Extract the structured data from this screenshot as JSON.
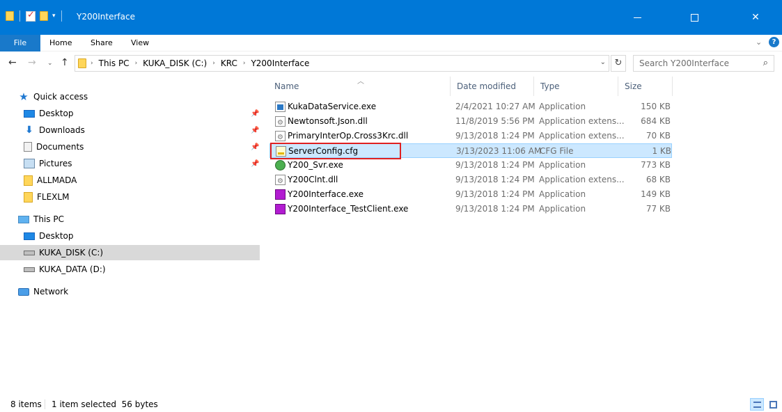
{
  "window": {
    "title": "Y200Interface",
    "min_icon": "minimize-icon",
    "max_icon": "maximize-icon",
    "close_label": "✕"
  },
  "ribbon": {
    "tabs": [
      {
        "label": "File",
        "active": true
      },
      {
        "label": "Home"
      },
      {
        "label": "Share"
      },
      {
        "label": "View"
      }
    ],
    "help_label": "?"
  },
  "address": {
    "crumbs": [
      "This PC",
      "KUKA_DISK (C:)",
      "KRC",
      "Y200Interface"
    ],
    "search_placeholder": "Search Y200Interface"
  },
  "nav_pane": {
    "quick_access": {
      "label": "Quick access",
      "items": [
        {
          "label": "Desktop",
          "icon": "desktop-icon",
          "pinned": true
        },
        {
          "label": "Downloads",
          "icon": "downloads-icon",
          "pinned": true
        },
        {
          "label": "Documents",
          "icon": "documents-icon",
          "pinned": true
        },
        {
          "label": "Pictures",
          "icon": "pictures-icon",
          "pinned": true
        },
        {
          "label": "ALLMADA",
          "icon": "folder-icon",
          "pinned": false
        },
        {
          "label": "FLEXLM",
          "icon": "folder-icon",
          "pinned": false
        }
      ]
    },
    "this_pc": {
      "label": "This PC",
      "items": [
        {
          "label": "Desktop",
          "icon": "desktop-icon"
        },
        {
          "label": "KUKA_DISK (C:)",
          "icon": "drive-icon",
          "selected": true
        },
        {
          "label": "KUKA_DATA (D:)",
          "icon": "drive-icon"
        }
      ]
    },
    "network": {
      "label": "Network"
    }
  },
  "columns": {
    "name": "Name",
    "date": "Date modified",
    "type": "Type",
    "size": "Size"
  },
  "files": [
    {
      "name": "KukaDataService.exe",
      "date": "2/4/2021 10:27 AM",
      "type": "Application",
      "size": "150 KB",
      "icon": "exe-icon"
    },
    {
      "name": "Newtonsoft.Json.dll",
      "date": "11/8/2019 5:56 PM",
      "type": "Application extens...",
      "size": "684 KB",
      "icon": "dll-icon"
    },
    {
      "name": "PrimaryInterOp.Cross3Krc.dll",
      "date": "9/13/2018 1:24 PM",
      "type": "Application extens...",
      "size": "70 KB",
      "icon": "dll-icon"
    },
    {
      "name": "ServerConfig.cfg",
      "date": "3/13/2023 11:06 AM",
      "type": "CFG File",
      "size": "1 KB",
      "icon": "cfg-icon",
      "selected": true
    },
    {
      "name": "Y200_Svr.exe",
      "date": "9/13/2018 1:24 PM",
      "type": "Application",
      "size": "773 KB",
      "icon": "server-icon"
    },
    {
      "name": "Y200Clnt.dll",
      "date": "9/13/2018 1:24 PM",
      "type": "Application extens...",
      "size": "68 KB",
      "icon": "dll-icon"
    },
    {
      "name": "Y200Interface.exe",
      "date": "9/13/2018 1:24 PM",
      "type": "Application",
      "size": "149 KB",
      "icon": "app-icon"
    },
    {
      "name": "Y200Interface_TestClient.exe",
      "date": "9/13/2018 1:24 PM",
      "type": "Application",
      "size": "77 KB",
      "icon": "app-icon"
    }
  ],
  "status": {
    "count": "8 items",
    "selection": "1 item selected  56 bytes"
  },
  "colors": {
    "titlebar": "#0078d7",
    "selection": "#cce8ff",
    "highlight_border": "#e02020"
  }
}
